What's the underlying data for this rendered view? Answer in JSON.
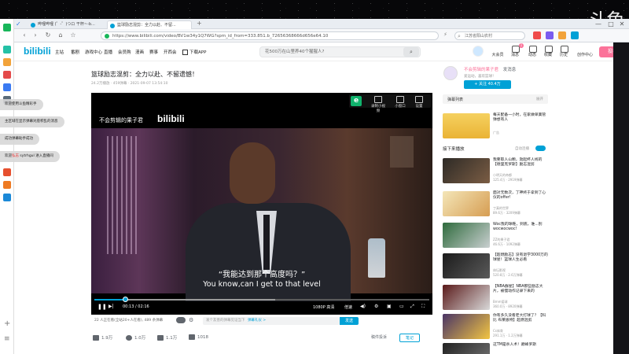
{
  "stream_watermark": "斗鱼",
  "browser": {
    "tabs": [
      {
        "label": "哔哩哔哩 (゜-゜)つロ 干杯~-b..."
      },
      {
        "label": "篮球励志混剪：全力以赴、不留..."
      }
    ],
    "url": "https://www.bilibili.com/video/BV1w34y1Q7WG?spm_id_from=333.851.b_72656368666d656e64.10",
    "search_placeholder": "江苏省阳山农村",
    "window_buttons": [
      "—",
      "□",
      "✕"
    ]
  },
  "site": {
    "logo": "bilibili",
    "nav": [
      "主站",
      "番剧",
      "游戏中心",
      "直播",
      "会员购",
      "漫画",
      "赛事",
      "开西会",
      "下载APP"
    ],
    "search_placeholder": "花500万在山里养40个猩猩人?",
    "search_icon": "search-icon",
    "header_right": [
      "大会员",
      "消息",
      "动态",
      "收藏",
      "历史",
      "创作中心"
    ],
    "message_badge": "1",
    "upload_label": "投稿"
  },
  "video": {
    "title": "篮球励志混剪：全力以赴、不留遗憾！",
    "meta": "24.2万播放 · 459弹幕 · 2021-09-07 13:54:10",
    "watermark_label": "不会剪辑的果子君",
    "watermark_logo": "bilibili",
    "subtitle_cn": "“我能达到那个高度吗？”",
    "subtitle_en": "You know,can I get to that level",
    "overlay": {
      "e_label": "e",
      "items": [
        "录制小视频",
        "小窗口",
        "设置"
      ]
    },
    "time_display": "00:13 / 02:16",
    "progress": 0.095,
    "quality": "1080P 高清",
    "speed": "倍速",
    "viewers": "22 人正在看(全站20+人在看)",
    "danmaku_count": "489 条弹幕",
    "danmaku_input_placeholder": "发个友善的弹幕见证当下",
    "danmaku_etiquette": "弹幕礼仪 >",
    "send_label": "发送"
  },
  "actions": [
    {
      "icon": "like-icon",
      "count": "1.9万"
    },
    {
      "icon": "coin-icon",
      "count": "1.0万"
    },
    {
      "icon": "favorite-icon",
      "count": "1.1万"
    },
    {
      "icon": "share-icon",
      "count": "1018"
    }
  ],
  "actions_right": {
    "report": "稿件投诉",
    "note": "笔记"
  },
  "uploader": {
    "name": "不会剪辑的果子君",
    "tag": "发消息",
    "desc": "爱运动，喜欢篮球！",
    "follow_label": "+ 关注 40.4万"
  },
  "sidebar": {
    "danmaku_list_label": "弹幕列表",
    "danmaku_list_action": "展开",
    "ad": {
      "title": "每天配备一小时，在家做单簧管弹想有人",
      "tag": "广告"
    },
    "up_next_label": "接下来播放",
    "autoplay_label": "自动连播",
    "recommendations": [
      {
        "title": "我要取人山颗，勃起杯人线的【德里克罗斯】励志混剪",
        "author": "小明天的帝都",
        "stats": "125.4万 · 2919弹幕"
      },
      {
        "title": "面对无数次，丁神终于拿到了心仪的offer!",
        "author": "丁真的世界",
        "stats": "89.6万 · 3209弹幕"
      },
      {
        "title": "Woc我的球鞋，到底，谁...别wocwocwoc!",
        "author": "ZZ的果子君",
        "stats": "46.6万 · 1092弹幕"
      },
      {
        "title": "【超燃励志】没有退学3000万的球星！篮球人生必看",
        "author": "体坛影视",
        "stats": "520.8万 · 2.6万弹幕"
      },
      {
        "title": "【NBA群星】NBA那些励志大片，被慢动作记录下来的",
        "author": "Bmm爱球",
        "stats": "360.0万 · 8920弹幕"
      },
      {
        "title": "你有多久没看老大打球了？【科比 布莱恩特】超燃混剪",
        "author": "Cs体育",
        "stats": "291.1万 · 1.2万弹幕"
      },
      {
        "title": "这TM是杀人术！巅峰罗斯",
        "author": "",
        "stats": ""
      }
    ]
  },
  "toasts": [
    {
      "text": "欢迎使用斗鱼精彩手"
    },
    {
      "text": "主区域在显示弹幕对座积乱的消息"
    },
    {
      "text": "成功弹幕助手成功"
    },
    {
      "pre": "欢迎",
      "highlight": "弘志",
      "post": " sytrhgul 进入直播间"
    }
  ]
}
